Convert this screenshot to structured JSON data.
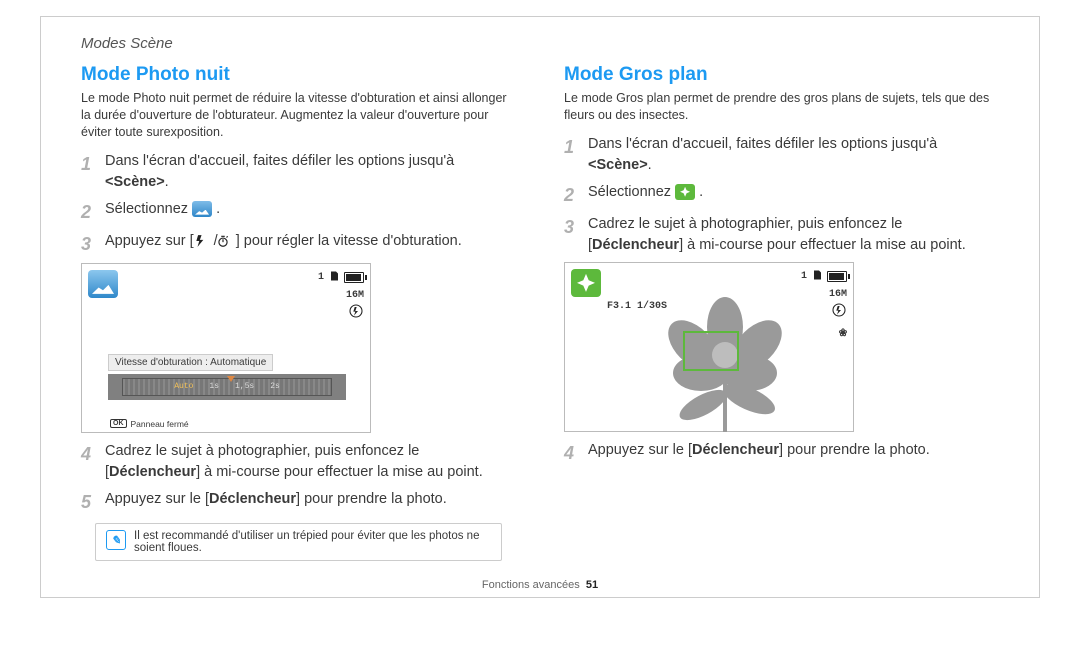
{
  "breadcrumb": "Modes Scène",
  "left": {
    "title": "Mode Photo nuit",
    "lede": "Le mode Photo nuit permet de réduire la vitesse d'obturation et ainsi allonger la durée d'ouverture de l'obturateur. Augmentez la valeur d'ouverture pour éviter toute surexposition.",
    "step1_pre": "Dans l'écran d'accueil, faites défiler les options jusqu'à ",
    "step1_bold": "<Scène>",
    "step1_post": ".",
    "step2": "Sélectionnez ",
    "step3_pre": "Appuyez sur [",
    "step3_post": "] pour régler la vitesse d'obturation.",
    "step4_pre": "Cadrez le sujet à photographier, puis enfoncez le [",
    "step4_bold": "Déclencheur",
    "step4_post": "] à mi-course pour effectuer la mise au point.",
    "step5_pre": "Appuyez sur le [",
    "step5_bold": "Déclencheur",
    "step5_post": "] pour prendre la photo.",
    "tip": "Il est recommandé d'utiliser un trépied pour éviter que les photos ne soient floues.",
    "lcd": {
      "shots_left": "1",
      "res_label": "16M",
      "shutter_label": "Vitesse d'obturation : Automatique",
      "ruler_auto": "Auto",
      "ruler_1s": "1s",
      "ruler_1_5s": "1,5s",
      "ruler_2s": "2s",
      "ok": "OK",
      "panel_closed": "Panneau fermé"
    }
  },
  "right": {
    "title": "Mode Gros plan",
    "lede": "Le mode Gros plan permet de prendre des gros plans de sujets, tels que des fleurs ou des insectes.",
    "step1_pre": "Dans l'écran d'accueil, faites défiler les options jusqu'à ",
    "step1_bold": "<Scène>",
    "step1_post": ".",
    "step2": "Sélectionnez ",
    "step3_pre": "Cadrez le sujet à photographier, puis enfoncez le [",
    "step3_bold": "Déclencheur",
    "step3_post": "] à mi-course pour effectuer la mise au point.",
    "step4_pre": "Appuyez sur le [",
    "step4_bold": "Déclencheur",
    "step4_post": "] pour prendre la photo.",
    "lcd": {
      "aperture": "F3.1 1/30S",
      "shots_left": "1",
      "res_label": "16M"
    }
  },
  "footer": {
    "label": "Fonctions avancées",
    "page": "51"
  }
}
